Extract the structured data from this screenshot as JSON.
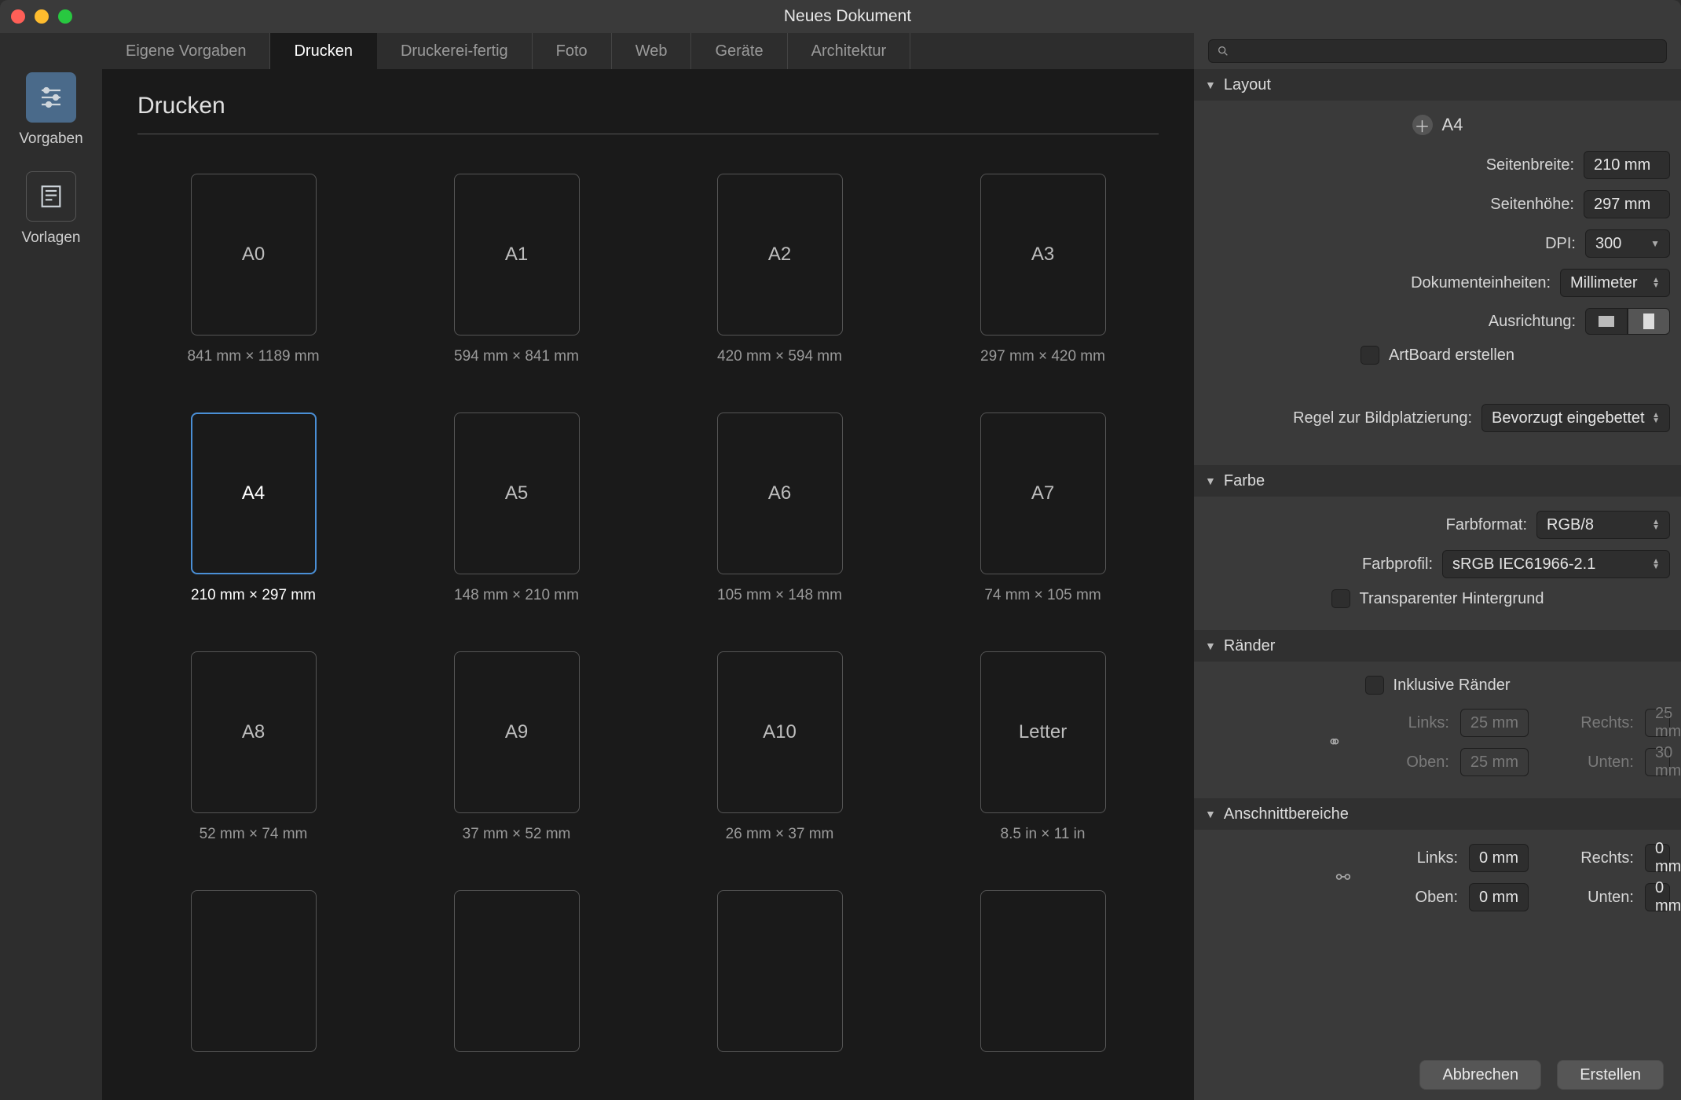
{
  "titlebar": {
    "title": "Neues Dokument"
  },
  "rail": {
    "items": [
      {
        "label": "Vorgaben"
      },
      {
        "label": "Vorlagen"
      }
    ]
  },
  "tabs": [
    {
      "label": "Eigene Vorgaben"
    },
    {
      "label": "Drucken"
    },
    {
      "label": "Druckerei-fertig"
    },
    {
      "label": "Foto"
    },
    {
      "label": "Web"
    },
    {
      "label": "Geräte"
    },
    {
      "label": "Architektur"
    }
  ],
  "content": {
    "header": "Drucken",
    "presets": [
      {
        "name": "A0",
        "dims": "841 mm × 1189 mm"
      },
      {
        "name": "A1",
        "dims": "594 mm × 841 mm"
      },
      {
        "name": "A2",
        "dims": "420 mm × 594 mm"
      },
      {
        "name": "A3",
        "dims": "297 mm × 420 mm"
      },
      {
        "name": "A4",
        "dims": "210 mm × 297 mm",
        "selected": true
      },
      {
        "name": "A5",
        "dims": "148 mm × 210 mm"
      },
      {
        "name": "A6",
        "dims": "105 mm × 148 mm"
      },
      {
        "name": "A7",
        "dims": "74 mm × 105 mm"
      },
      {
        "name": "A8",
        "dims": "52 mm × 74 mm"
      },
      {
        "name": "A9",
        "dims": "37 mm × 52 mm"
      },
      {
        "name": "A10",
        "dims": "26 mm × 37 mm"
      },
      {
        "name": "Letter",
        "dims": "8.5 in × 11 in"
      },
      {
        "name": "",
        "dims": ""
      },
      {
        "name": "",
        "dims": ""
      },
      {
        "name": "",
        "dims": ""
      },
      {
        "name": "",
        "dims": ""
      }
    ]
  },
  "panel": {
    "layout": {
      "title": "Layout",
      "preset_name": "A4",
      "page_width_label": "Seitenbreite:",
      "page_width": "210 mm",
      "page_height_label": "Seitenhöhe:",
      "page_height": "297 mm",
      "dpi_label": "DPI:",
      "dpi": "300",
      "units_label": "Dokumenteinheiten:",
      "units": "Millimeter",
      "orientation_label": "Ausrichtung:",
      "artboard_label": "ArtBoard erstellen",
      "placement_label": "Regel zur Bildplatzierung:",
      "placement": "Bevorzugt eingebettet"
    },
    "color": {
      "title": "Farbe",
      "format_label": "Farbformat:",
      "format": "RGB/8",
      "profile_label": "Farbprofil:",
      "profile": "sRGB IEC61966-2.1",
      "transparent_label": "Transparenter Hintergrund"
    },
    "margins": {
      "title": "Ränder",
      "inclusive_label": "Inklusive Ränder",
      "left_label": "Links:",
      "left": "25 mm",
      "right_label": "Rechts:",
      "right": "25 mm",
      "top_label": "Oben:",
      "top": "25 mm",
      "bottom_label": "Unten:",
      "bottom": "30 mm"
    },
    "bleed": {
      "title": "Anschnittbereiche",
      "left_label": "Links:",
      "left": "0 mm",
      "right_label": "Rechts:",
      "right": "0 mm",
      "top_label": "Oben:",
      "top": "0 mm",
      "bottom_label": "Unten:",
      "bottom": "0 mm"
    }
  },
  "footer": {
    "cancel": "Abbrechen",
    "create": "Erstellen"
  }
}
